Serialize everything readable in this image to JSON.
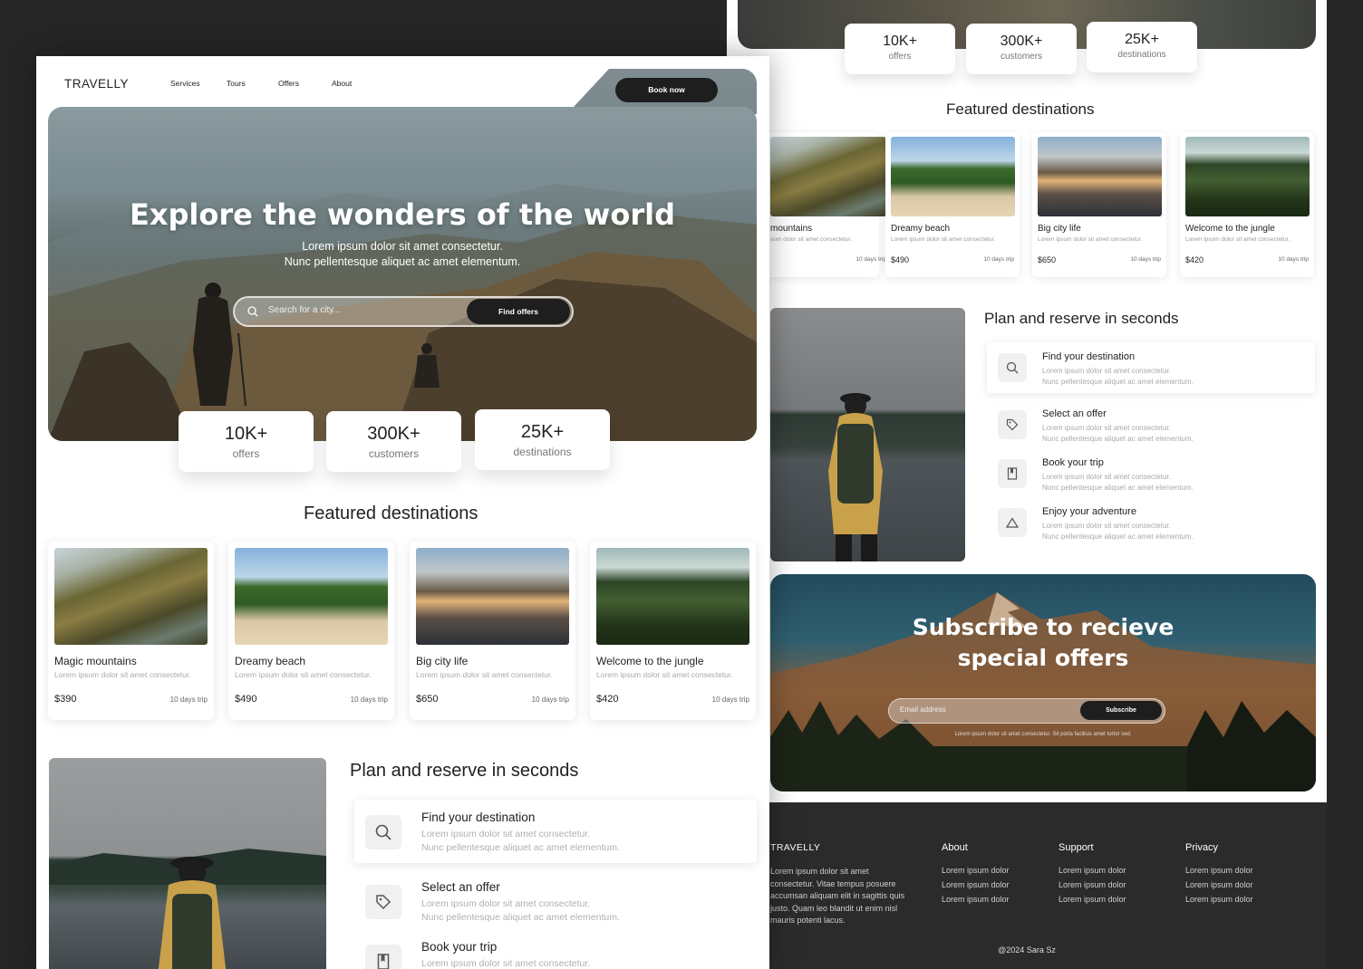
{
  "brand": "TRAVELLY",
  "nav": [
    "Services",
    "Tours",
    "Offers",
    "About"
  ],
  "book_button": "Book now",
  "hero": {
    "title": "Explore the wonders of the world",
    "subtitle_line1": "Lorem ipsum dolor sit amet consectetur.",
    "subtitle_line2": "Nunc pellentesque aliquet ac amet elementum.",
    "search_placeholder": "Search for a city...",
    "search_button": "Find offers"
  },
  "stats": [
    {
      "value": "10K+",
      "label": "offers"
    },
    {
      "value": "300K+",
      "label": "customers"
    },
    {
      "value": "25K+",
      "label": "destinations"
    }
  ],
  "featured_title": "Featured destinations",
  "destinations": [
    {
      "title": "Magic mountains",
      "desc": "Lorem ipsum dolor sit amet consectetur.",
      "price": "$390",
      "duration": "10 days trip"
    },
    {
      "title": "Dreamy beach",
      "desc": "Lorem ipsum dolor sit amet consectetur.",
      "price": "$490",
      "duration": "10 days trip"
    },
    {
      "title": "Big city life",
      "desc": "Lorem ipsum dolor sit amet consectetur.",
      "price": "$650",
      "duration": "10 days trip"
    },
    {
      "title": "Welcome to the jungle",
      "desc": "Lorem ipsum dolor sit amet consectetur.",
      "price": "$420",
      "duration": "10 days trip"
    }
  ],
  "back_first_card_title": "mountains",
  "back_first_card_desc": "sum dolor sit amet consectetur.",
  "plan_title": "Plan and reserve in seconds",
  "steps": [
    {
      "title": "Find your destination",
      "line1": "Lorem ipsum dolor sit amet consectetur.",
      "line2": "Nunc pellentesque aliquet ac amet elementum.",
      "icon": "search-icon"
    },
    {
      "title": "Select an offer",
      "line1": "Lorem ipsum dolor sit amet consectetur.",
      "line2": "Nunc pellentesque aliquet ac amet elementum.",
      "icon": "tag-icon"
    },
    {
      "title": "Book your trip",
      "line1": "Lorem ipsum dolor sit amet consectetur.",
      "line2": "Nunc pellentesque aliquet ac amet elementum.",
      "icon": "bookmark-icon"
    },
    {
      "title": "Enjoy your adventure",
      "line1": "Lorem ipsum dolor sit amet consectetur.",
      "line2": "Nunc pellentesque aliquet ac amet elementum.",
      "icon": "mountain-icon"
    }
  ],
  "subscribe": {
    "title_line1": "Subscribe to recieve",
    "title_line2": "special offers",
    "email_placeholder": "Email address",
    "button": "Subscribe",
    "note": "Lorem ipsum dolor sit amet consectetur. Sit porta facilisis amet tortor sed."
  },
  "footer": {
    "brand": "TRAVELLY",
    "about_text": "Lorem ipsum dolor sit amet consectetur. Vitae tempus posuere accumsan aliquam elit in sagittis quis justo. Quam leo blandit ut enim nisl mauris potenti lacus.",
    "columns": [
      {
        "heading": "About",
        "links": [
          "Lorem ipsum dolor",
          "Lorem ipsum dolor",
          "Lorem ipsum dolor"
        ]
      },
      {
        "heading": "Support",
        "links": [
          "Lorem ipsum dolor",
          "Lorem ipsum dolor",
          "Lorem ipsum dolor"
        ]
      },
      {
        "heading": "Privacy",
        "links": [
          "Lorem ipsum dolor",
          "Lorem ipsum dolor",
          "Lorem ipsum dolor"
        ]
      }
    ],
    "copyright": "@2024 Sara Sz"
  },
  "colors": {
    "dark": "#1e1e1e",
    "background": "#262626",
    "muted_text": "#aaaaaa"
  }
}
